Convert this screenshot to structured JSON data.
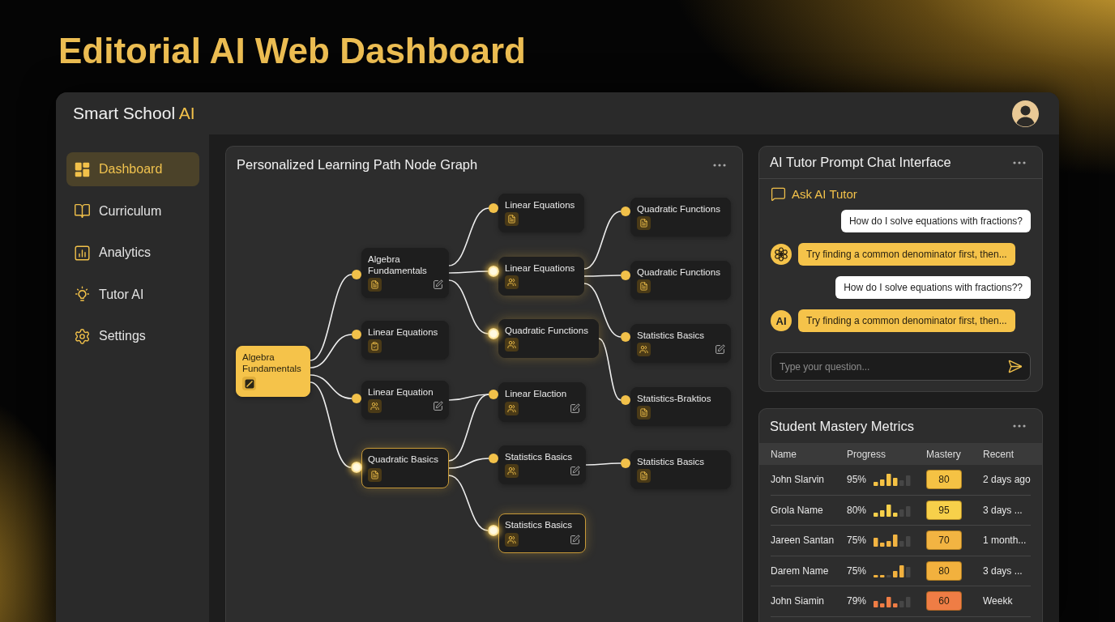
{
  "page_title": "Editorial AI Web Dashboard",
  "header": {
    "brand": {
      "name": "Smart School",
      "accent": "AI"
    }
  },
  "sidebar": {
    "items": [
      {
        "label": "Dashboard",
        "selected": true
      },
      {
        "label": "Curriculum",
        "selected": false
      },
      {
        "label": "Analytics",
        "selected": false
      },
      {
        "label": "Tutor AI",
        "selected": false
      },
      {
        "label": "Settings",
        "selected": false
      }
    ]
  },
  "graph": {
    "title": "Personalized Learning Path Node Graph",
    "columns": [
      {
        "nodes": [
          {
            "label": "Algebra Fundamentals",
            "active": true,
            "highlighted": false,
            "glowing": false,
            "editable": false
          }
        ]
      },
      {
        "nodes": [
          {
            "label": "Algebra Fundamentals",
            "active": false,
            "highlighted": false,
            "glowing": false,
            "editable": true
          },
          {
            "label": "Linear Equations",
            "active": false,
            "highlighted": false,
            "glowing": false,
            "editable": false
          },
          {
            "label": "Linear Equation",
            "active": false,
            "highlighted": false,
            "glowing": false,
            "editable": true
          },
          {
            "label": "Quadratic Basics",
            "active": false,
            "highlighted": true,
            "glowing": true,
            "editable": false
          }
        ]
      },
      {
        "nodes": [
          {
            "label": "Linear Equations",
            "active": false,
            "highlighted": false,
            "glowing": false,
            "editable": false
          },
          {
            "label": "Linear Equations",
            "active": false,
            "highlighted": false,
            "glowing": true,
            "editable": false
          },
          {
            "label": "Quadratic Functions",
            "active": false,
            "highlighted": false,
            "glowing": true,
            "editable": false
          },
          {
            "label": "Linear Elaction",
            "active": false,
            "highlighted": false,
            "glowing": false,
            "editable": true
          },
          {
            "label": "Statistics Basics",
            "active": false,
            "highlighted": false,
            "glowing": false,
            "editable": true
          },
          {
            "label": "Statistics Basics",
            "active": false,
            "highlighted": true,
            "glowing": true,
            "editable": true
          }
        ]
      },
      {
        "nodes": [
          {
            "label": "Quadratic Functions",
            "active": false,
            "highlighted": false,
            "glowing": false,
            "editable": false
          },
          {
            "label": "Quadratic Functions",
            "active": false,
            "highlighted": false,
            "glowing": false,
            "editable": false
          },
          {
            "label": "Statistics Basics",
            "active": false,
            "highlighted": false,
            "glowing": false,
            "editable": true
          },
          {
            "label": "Statistics-Braktios",
            "active": false,
            "highlighted": false,
            "glowing": false,
            "editable": false
          },
          {
            "label": "Statistics Basics",
            "active": false,
            "highlighted": false,
            "glowing": false,
            "editable": false
          }
        ]
      }
    ]
  },
  "chat": {
    "title": "AI Tutor Prompt Chat Interface",
    "prompt_label": "Ask AI Tutor",
    "messages": [
      {
        "kind": "user",
        "text": "How do I solve equations with fractions?"
      },
      {
        "kind": "ai",
        "text": "Try finding a common denominator first, then..."
      },
      {
        "kind": "user",
        "text": "How do I solve equations with fractions??"
      },
      {
        "kind": "ai",
        "avatar_text": "AI",
        "text": "Try finding a common denominator first, then..."
      }
    ],
    "input": {
      "placeholder": "Type your question..."
    }
  },
  "metrics": {
    "title": "Student Mastery Metrics",
    "columns": [
      "Name",
      "Progress",
      "Mastery",
      "Recent"
    ],
    "rows": [
      {
        "name": "John Slarvin",
        "progress": "95%",
        "mastery": "80",
        "color": "#f5c244",
        "recent": "2 days ago"
      },
      {
        "name": "Grola Name",
        "progress": "80%",
        "mastery": "95",
        "color": "#f7d04a",
        "recent": "3 days ..."
      },
      {
        "name": "Jareen Santan",
        "progress": "75%",
        "mastery": "70",
        "color": "#f2b442",
        "recent": "1 month..."
      },
      {
        "name": "Darem Name",
        "progress": "75%",
        "mastery": "80",
        "color": "#f2b13e",
        "recent": "3 days ..."
      },
      {
        "name": "John Siamin",
        "progress": "79%",
        "mastery": "60",
        "color": "#ef7d45",
        "recent": "Weekk"
      }
    ]
  }
}
